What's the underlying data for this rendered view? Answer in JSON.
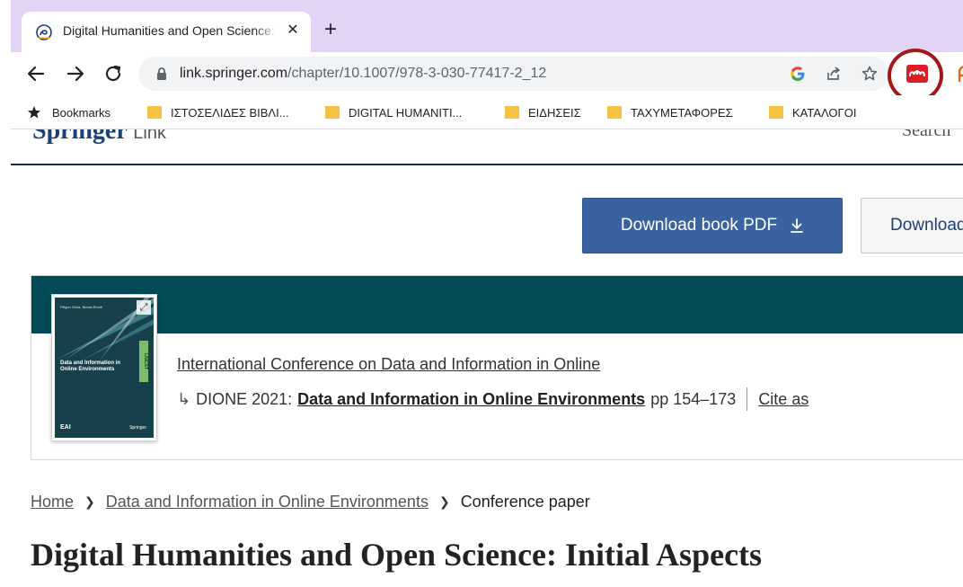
{
  "browser": {
    "tab": {
      "title": "Digital Humanities and Open Science: Initial Aspects",
      "close_glyph": "✕"
    },
    "new_tab_glyph": "+",
    "nav": {
      "back_icon": "arrow-left-icon",
      "forward_icon": "arrow-right-icon",
      "reload_icon": "reload-icon"
    },
    "address": {
      "host": "link.springer.com",
      "path": "/chapter/10.1007/978-3-030-77417-2_12"
    },
    "toolbar_icons": [
      "google-icon",
      "share-icon",
      "bookmark-star-icon",
      "mendeley-extension-icon",
      "extension-icon"
    ],
    "highlight_color": "#a31919",
    "tabstrip_color": "#e3d3f5"
  },
  "bookmarks": [
    {
      "label": "Bookmarks",
      "icon": "star-icon"
    },
    {
      "label": "ΙΣΤΟΣΕΛΙΔΕΣ ΒΙΒΛΙ...",
      "icon": "folder-icon"
    },
    {
      "label": "DIGITAL HUMANITI...",
      "icon": "folder-icon"
    },
    {
      "label": "ΕΙΔΗΣΕΙΣ",
      "icon": "folder-icon"
    },
    {
      "label": "ΤΑΧΥΜΕΤΑΦΟΡΕΣ",
      "icon": "folder-icon"
    },
    {
      "label": "ΚΑΤΑΛΟΓΟΙ",
      "icon": "folder-icon"
    }
  ],
  "site": {
    "brand": "Springer",
    "brand_suffix": "Link",
    "search_label": "Search",
    "download_book_pdf": "Download book PDF",
    "download_secondary": "Download",
    "download_icon": "download-icon"
  },
  "book": {
    "cover": {
      "author_line": "Filippo Gioia, Nicola Ebolli",
      "title": "Data and Information in Online Environments",
      "series_strip": "LNICST",
      "publisher_left": "EAI",
      "publisher_right": "Springer"
    },
    "conference_link": "International Conference on Data and Information in Online",
    "series_prefix": "DIONE 2021:",
    "book_link": "Data and Information in Online Environments",
    "pages": "pp 154–173",
    "cite_as": "Cite as"
  },
  "breadcrumb": {
    "home": "Home",
    "book": "Data and Information in Online Environments",
    "current": "Conference paper"
  },
  "chapter_title": "Digital Humanities and Open Science: Initial Aspects",
  "colors": {
    "primary_button": "#3a62a0",
    "book_band": "#004b55",
    "brand_rule": "#0c2d57"
  }
}
